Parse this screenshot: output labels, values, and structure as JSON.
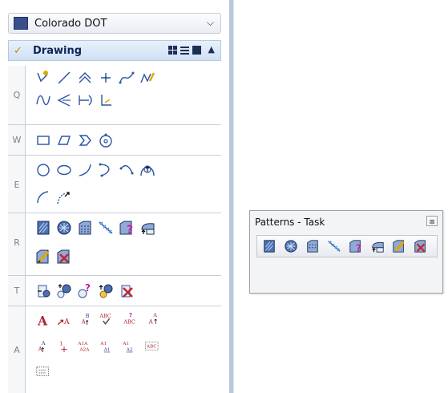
{
  "workflow": {
    "label": "Colorado DOT",
    "icon": "workflow-icon",
    "chevron": "❯"
  },
  "group": {
    "title": "Drawing",
    "icon": "drawing-group-icon",
    "collapse": "^",
    "views": [
      "icon-view",
      "list-view",
      "panel-view"
    ]
  },
  "sections": [
    {
      "key": "Q",
      "tools": [
        "place-smartline-icon",
        "place-line-icon",
        "multi-line-icon",
        "place-point-icon",
        "place-stream-curve-icon",
        "place-note-icon",
        "place-arc-curve-icon",
        "mirror-line-icon",
        "dimension-icon",
        "axis-icon"
      ]
    },
    {
      "key": "W",
      "tools": [
        "place-block-icon",
        "place-shape-icon",
        "place-orthogonal-shape-icon",
        "place-regular-polygon-icon"
      ]
    },
    {
      "key": "E",
      "tools": [
        "place-circle-icon",
        "place-ellipse-icon",
        "place-arc-icon",
        "modify-arc-icon",
        "arc-by-points-icon",
        "half-ellipse-icon",
        "quarter-arc-icon",
        "arc-edit-icon"
      ]
    },
    {
      "key": "R",
      "tools": [
        "hatch-area-icon",
        "crosshatch-area-icon",
        "pattern-area-icon",
        "linear-pattern-icon",
        "show-pattern-icon",
        "match-pattern-icon",
        "change-pattern-icon",
        "delete-pattern-icon"
      ]
    },
    {
      "key": "T",
      "tools": [
        "place-cell-icon",
        "select-cell-icon",
        "identify-cell-icon",
        "replace-cell-icon",
        "drop-cell-icon"
      ]
    },
    {
      "key": "A",
      "tools": [
        "place-text-icon",
        "place-text-leader-icon",
        "increment-text-icon",
        "spell-check-icon",
        "find-text-icon",
        "edit-text-icon",
        "copy-text-icon",
        "place-node-icon",
        "copy-increment-text-icon",
        "match-text-icon",
        "change-text-icon",
        "display-text-icon",
        "text-fields-icon"
      ]
    }
  ],
  "toolbox": {
    "title": "Patterns - Task",
    "close": "⊠",
    "tools": [
      "hatch-area-icon",
      "crosshatch-area-icon",
      "pattern-area-icon",
      "linear-pattern-icon",
      "show-pattern-icon",
      "match-pattern-icon",
      "change-pattern-icon",
      "delete-pattern-icon"
    ]
  },
  "colors": {
    "accent": "#b9c6dc",
    "icon_blue": "#2b55a6",
    "icon_red": "#c0262e",
    "icon_gold": "#e1a800"
  },
  "text_labels": {
    "big_a": "A",
    "small_a": "A",
    "b_top": "B",
    "abc1": "ABC",
    "abc2": "ABC",
    "q": "?",
    "a1a": "A1A",
    "a2a": "A2A",
    "a1": "A1",
    "a1b": "A1",
    "a2": "A2",
    "abc_box": "ABC",
    "one": "1"
  }
}
